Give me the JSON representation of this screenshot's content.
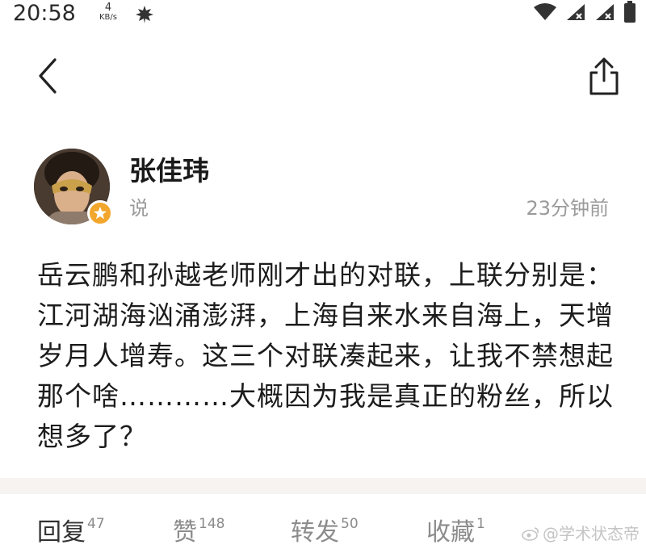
{
  "status_bar": {
    "time": "20:58",
    "net_speed_value": "4",
    "net_speed_unit": "KB/s",
    "icons": [
      "leaf-icon",
      "wifi-icon",
      "signal-x-icon",
      "signal-x-icon",
      "battery-icon"
    ]
  },
  "nav": {
    "back_icon": "chevron-left-icon",
    "share_icon": "share-icon"
  },
  "author": {
    "name": "张佳玮",
    "subtitle": "说",
    "time": "23分钟前",
    "badge_color": "#f2a62c"
  },
  "post": {
    "text": "岳云鹏和孙越老师刚才出的对联，上联分别是：江河湖海汹涌澎湃，上海自来水来自海上，天增岁月人增寿。这三个对联凑起来，让我不禁想起那个啥…………大概因为我是真正的粉丝，所以想多了？"
  },
  "actions": [
    {
      "label": "回复",
      "count": "47"
    },
    {
      "label": "赞",
      "count": "148"
    },
    {
      "label": "转发",
      "count": "50"
    },
    {
      "label": "收藏",
      "count": "1"
    }
  ],
  "watermark": {
    "text": "@学术状态帝"
  }
}
